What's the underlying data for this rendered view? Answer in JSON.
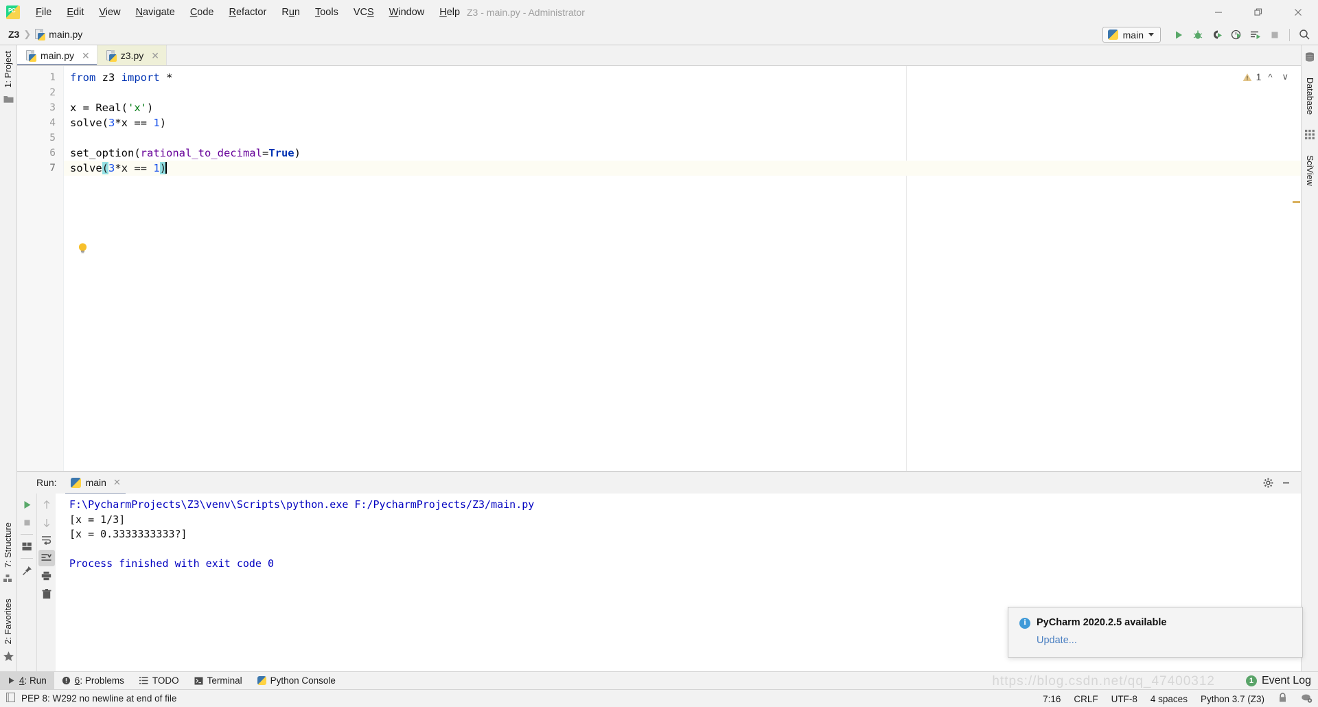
{
  "window": {
    "title": "Z3 - main.py - Administrator",
    "app_icon": "pycharm-logo",
    "controls": [
      "minimize",
      "restore",
      "close"
    ]
  },
  "menu": [
    {
      "label": "File",
      "mnemonic": "F"
    },
    {
      "label": "Edit",
      "mnemonic": "E"
    },
    {
      "label": "View",
      "mnemonic": "V"
    },
    {
      "label": "Navigate",
      "mnemonic": "N"
    },
    {
      "label": "Code",
      "mnemonic": "C"
    },
    {
      "label": "Refactor",
      "mnemonic": "R"
    },
    {
      "label": "Run",
      "mnemonic": "u"
    },
    {
      "label": "Tools",
      "mnemonic": "T"
    },
    {
      "label": "VCS",
      "mnemonic": "S"
    },
    {
      "label": "Window",
      "mnemonic": "W"
    },
    {
      "label": "Help",
      "mnemonic": "H"
    }
  ],
  "breadcrumb": {
    "root": "Z3",
    "separator": "❯",
    "file": "main.py"
  },
  "toolbar": {
    "run_config": "main",
    "buttons": [
      {
        "name": "run-button",
        "icon": "play-icon"
      },
      {
        "name": "debug-button",
        "icon": "bug-icon"
      },
      {
        "name": "run-coverage-button",
        "icon": "coverage-icon"
      },
      {
        "name": "profile-button",
        "icon": "profile-icon"
      },
      {
        "name": "run-with-options-button",
        "icon": "run-list-icon"
      },
      {
        "name": "stop-button",
        "icon": "stop-icon"
      },
      {
        "name": "search-everywhere-button",
        "icon": "search-icon"
      }
    ]
  },
  "left_strip": [
    {
      "label": "1: Project",
      "mnemonic": "1",
      "icon": "folder-icon"
    },
    {
      "label": "7: Structure",
      "mnemonic": "7",
      "icon": "structure-icon"
    },
    {
      "label": "2: Favorites",
      "mnemonic": "2",
      "icon": "star-icon"
    }
  ],
  "right_strip": [
    {
      "label": "Database",
      "icon": "database-icon"
    },
    {
      "label": "SciView",
      "icon": "grid-icon"
    }
  ],
  "editor": {
    "tabs": [
      {
        "label": "main.py",
        "active": true,
        "icon": "python-file-icon"
      },
      {
        "label": "z3.py",
        "active": false,
        "icon": "python-file-icon"
      }
    ],
    "warning_count": "1",
    "gutter_hint": "intention-bulb",
    "lines": [
      {
        "n": "1",
        "tokens": [
          {
            "t": "from ",
            "c": "kw"
          },
          {
            "t": "z3 ",
            "c": "txt"
          },
          {
            "t": "import ",
            "c": "kw"
          },
          {
            "t": "*",
            "c": "txt"
          }
        ]
      },
      {
        "n": "2",
        "tokens": []
      },
      {
        "n": "3",
        "tokens": [
          {
            "t": "x = Real(",
            "c": "txt"
          },
          {
            "t": "'x'",
            "c": "s"
          },
          {
            "t": ")",
            "c": "txt"
          }
        ]
      },
      {
        "n": "4",
        "tokens": [
          {
            "t": "solve(",
            "c": "txt"
          },
          {
            "t": "3",
            "c": "n"
          },
          {
            "t": "*x == ",
            "c": "txt"
          },
          {
            "t": "1",
            "c": "n"
          },
          {
            "t": ")",
            "c": "txt"
          }
        ]
      },
      {
        "n": "5",
        "tokens": []
      },
      {
        "n": "6",
        "tokens": [
          {
            "t": "set_option(",
            "c": "txt"
          },
          {
            "t": "rational_to_decimal",
            "c": "kwarg"
          },
          {
            "t": "=",
            "c": "txt"
          },
          {
            "t": "True",
            "c": "bl"
          },
          {
            "t": ")",
            "c": "txt"
          }
        ]
      },
      {
        "n": "7",
        "tokens": [
          {
            "t": "solve",
            "c": "txt"
          },
          {
            "t": "(",
            "c": "brk"
          },
          {
            "t": "3",
            "c": "n"
          },
          {
            "t": "*x == ",
            "c": "txt"
          },
          {
            "t": "1",
            "c": "n"
          },
          {
            "t": ")",
            "c": "brk"
          }
        ],
        "current": true
      }
    ]
  },
  "run_panel": {
    "label": "Run:",
    "tab": "main",
    "tab_icon": "python-icon",
    "header_buttons": [
      {
        "name": "settings-button",
        "icon": "gear-icon"
      },
      {
        "name": "hide-button",
        "icon": "minimize-icon"
      }
    ],
    "left_tools": [
      {
        "name": "rerun-button",
        "icon": "play-icon"
      },
      {
        "name": "stop-process-button",
        "icon": "stop-icon"
      },
      {
        "name": "layout-button",
        "icon": "layout-icon"
      },
      {
        "name": "pin-tab-button",
        "icon": "pin-icon"
      }
    ],
    "right_tools": [
      {
        "name": "prev-occurrence-button",
        "icon": "arrow-up-icon"
      },
      {
        "name": "next-occurrence-button",
        "icon": "arrow-down-icon"
      },
      {
        "name": "soft-wrap-button",
        "icon": "wrap-icon"
      },
      {
        "name": "scroll-to-end-button",
        "icon": "scroll-end-icon",
        "selected": true
      },
      {
        "name": "print-button",
        "icon": "printer-icon"
      },
      {
        "name": "clear-all-button",
        "icon": "trash-icon"
      }
    ],
    "output": [
      {
        "text": "F:\\PycharmProjects\\Z3\\venv\\Scripts\\python.exe F:/PycharmProjects/Z3/main.py",
        "kind": "cmd"
      },
      {
        "text": "[x = 1/3]",
        "kind": "out"
      },
      {
        "text": "[x = 0.3333333333?]",
        "kind": "out"
      },
      {
        "text": "",
        "kind": "out"
      },
      {
        "text": "Process finished with exit code 0",
        "kind": "cmd"
      }
    ]
  },
  "notification": {
    "icon": "info-icon",
    "title": "PyCharm 2020.2.5 available",
    "action": "Update..."
  },
  "bottom_bar": {
    "items": [
      {
        "label": "4: Run",
        "mnemonic": "4",
        "icon": "play-icon",
        "active": true
      },
      {
        "label": "6: Problems",
        "mnemonic": "6",
        "icon": "problems-icon",
        "active": false
      },
      {
        "label": "TODO",
        "icon": "todo-icon",
        "active": false
      },
      {
        "label": "Terminal",
        "icon": "terminal-icon",
        "active": false
      },
      {
        "label": "Python Console",
        "icon": "python-icon",
        "active": false
      }
    ],
    "event_log": {
      "label": "Event Log",
      "count": "1"
    }
  },
  "status_bar": {
    "message": "PEP 8: W292 no newline at end of file",
    "message_icon": "inspection-icon",
    "caret_position": "7:16",
    "line_separator": "CRLF",
    "encoding": "UTF-8",
    "indent": "4 spaces",
    "interpreter": "Python 3.7 (Z3)",
    "lock_icon": "lock-icon",
    "notifications_icon": "notifications-gear-icon"
  },
  "watermark": "https://blog.csdn.net/qq_47400312",
  "colors": {
    "accent": "#4a7fc1",
    "keyword": "#0033b3",
    "string": "#067d17",
    "number": "#1750eb",
    "kwarg": "#660099",
    "console_cmd": "#0000c0",
    "bracket_match": "#93e0e3",
    "current_line": "#fdfcf3",
    "badge_green": "#5aa469"
  }
}
